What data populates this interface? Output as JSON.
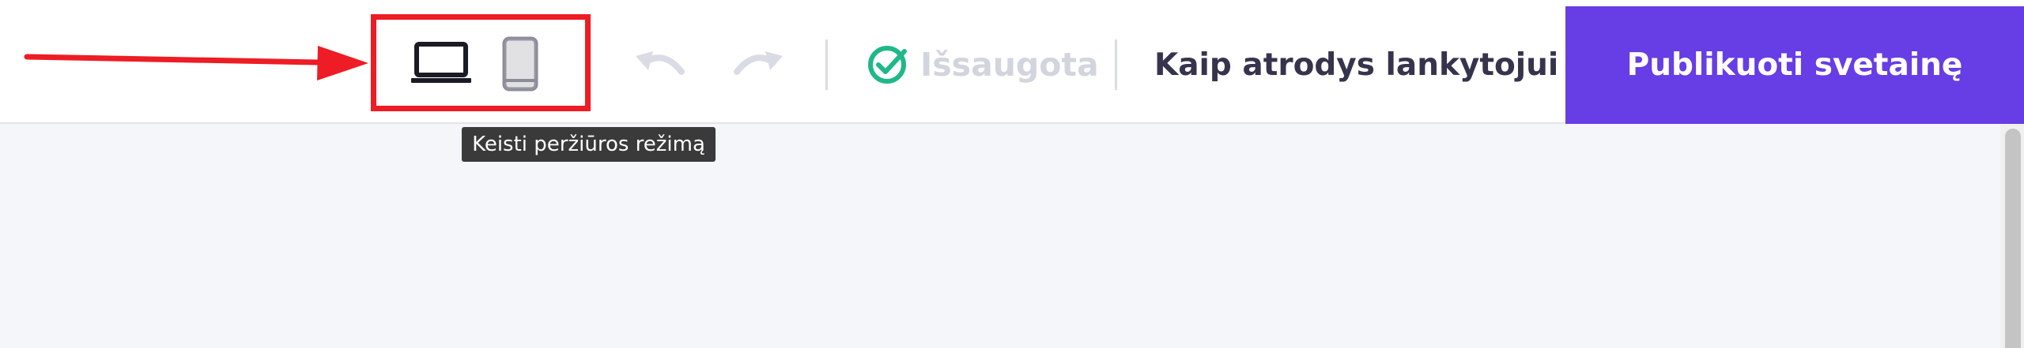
{
  "toolbar": {
    "view_modes": [
      {
        "name": "desktop",
        "icon": "laptop-icon"
      },
      {
        "name": "mobile",
        "icon": "mobile-icon"
      }
    ],
    "undo_icon": "undo-icon",
    "redo_icon": "redo-icon",
    "save_status": {
      "label": "Išsaugota",
      "icon": "check-circle-icon",
      "icon_color": "#1fb889"
    },
    "preview_label": "Kaip atrodys lankytojui",
    "publish_label": "Publikuoti svetainę"
  },
  "tooltip": {
    "text": "Keisti peržiūros režimą"
  },
  "annotation": {
    "color": "#ee1c24"
  },
  "colors": {
    "accent": "#673de6",
    "text_dark": "#36344d",
    "muted": "#d3d5de",
    "background": "#f5f6fa"
  }
}
